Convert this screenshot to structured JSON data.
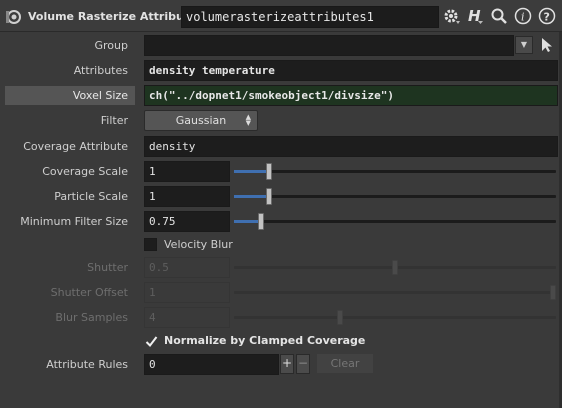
{
  "header": {
    "node_type": "Volume Rasterize Attributes",
    "node_name": "volumerasterizeattributes1",
    "icons": [
      "gear-icon",
      "help-h-icon",
      "search-icon",
      "info-icon",
      "question-icon"
    ]
  },
  "params": {
    "group": {
      "label": "Group",
      "value": ""
    },
    "attributes": {
      "label": "Attributes",
      "value": "density temperature"
    },
    "voxel_size": {
      "label": "Voxel Size",
      "value": "ch(\"../dopnet1/smokeobject1/divsize\")"
    },
    "filter": {
      "label": "Filter",
      "value": "Gaussian"
    },
    "coverage_attribute": {
      "label": "Coverage Attribute",
      "value": "density"
    },
    "coverage_scale": {
      "label": "Coverage Scale",
      "value": "1",
      "slider_fraction": 0.11
    },
    "particle_scale": {
      "label": "Particle Scale",
      "value": "1",
      "slider_fraction": 0.11
    },
    "minimum_filter_size": {
      "label": "Minimum Filter Size",
      "value": "0.75",
      "slider_fraction": 0.085
    },
    "velocity_blur": {
      "label": "Velocity Blur",
      "checked": false
    },
    "shutter": {
      "label": "Shutter",
      "value": "0.5",
      "slider_fraction": 0.5
    },
    "shutter_offset": {
      "label": "Shutter Offset",
      "value": "1",
      "slider_fraction": 1.0
    },
    "blur_samples": {
      "label": "Blur Samples",
      "value": "4",
      "slider_fraction": 0.33
    },
    "normalize": {
      "label": "Normalize by Clamped Coverage",
      "checked": true
    },
    "attribute_rules": {
      "label": "Attribute Rules",
      "value": "0",
      "plus": "+",
      "minus": "−",
      "clear": "Clear"
    }
  },
  "colors": {
    "slider_fill": "#3f6fb0",
    "expression_field": "#1e3420",
    "background": "#3a3a3a"
  }
}
